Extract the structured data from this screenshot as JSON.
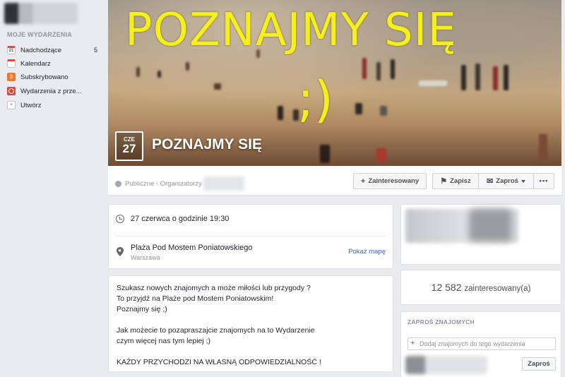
{
  "sidebar": {
    "heading": "MOJE WYDARZENIA",
    "items": [
      {
        "label": "Nadchodzące",
        "count": "5",
        "icon": "calendar-day-icon",
        "icon_text": "21"
      },
      {
        "label": "Kalendarz",
        "icon": "calendar-icon"
      },
      {
        "label": "Subskrybowano",
        "icon": "rss-icon"
      },
      {
        "label": "Wydarzenia z prze...",
        "icon": "clock-icon"
      },
      {
        "label": "Utwórz",
        "icon": "plus-icon",
        "icon_text": "+"
      }
    ]
  },
  "cover": {
    "overlay_text": "POZNAJMY SIĘ",
    "smiley": ";)",
    "date": {
      "month": "CZE",
      "day": "27"
    },
    "event_name": "POZNAJMY SIĘ",
    "text_color": "#f6ef1e"
  },
  "action_bar": {
    "privacy": "Publiczne · Organizatorzy",
    "interested": "Zainteresowany",
    "save": "Zapisz",
    "invite": "Zaproś",
    "more": "•••"
  },
  "details": {
    "time": "27 czerwca o godzinie 19:30",
    "location": "Plaża Pod Mostem Poniatowskiego",
    "city": "Warszawa",
    "map_link": "Pokaż mapę"
  },
  "description": {
    "lines": [
      "Szukasz nowych znajomych a może miłości lub przygody ?",
      "To przyjdź na Plaże pod Mostem Poniatowskim!",
      "Poznajmy się ;)",
      "",
      "Jak możecie to pozapraszajcie znajomych na to Wydarzenie",
      "czym więcej nas tym lepiej ;)",
      "",
      "KAŻDY PRZYCHODZI NA WŁASNĄ ODPOWIEDZIALNOŚĆ !"
    ]
  },
  "stats": {
    "interested_count": "12 582",
    "interested_label": "zainteresowany(a)"
  },
  "invite_friends": {
    "heading": "ZAPROŚ ZNAJOMYCH",
    "placeholder": "Dodaj znajomych do tego wydarzenia",
    "invite_button": "Zaproś"
  },
  "colors": {
    "link": "#4267b2",
    "background": "#e9ebee"
  }
}
